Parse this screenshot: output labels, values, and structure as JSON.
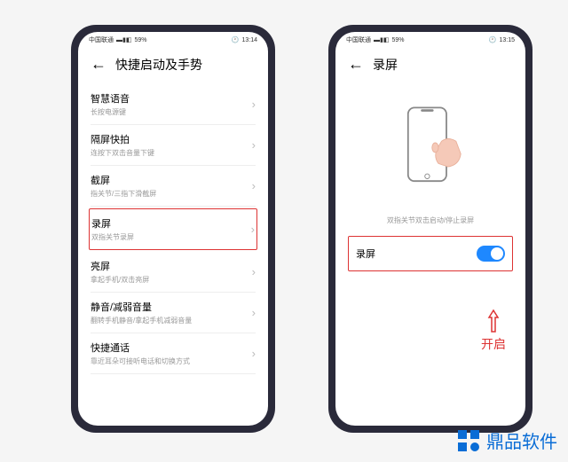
{
  "status": {
    "carrier": "中国联通",
    "signal": "▬▮◧",
    "battery": "59%",
    "time_left": "13:14",
    "time_right": "13:15"
  },
  "phone1": {
    "title": "快捷启动及手势",
    "items": [
      {
        "title": "智慧语音",
        "subtitle": "长按电源键"
      },
      {
        "title": "隔屏快拍",
        "subtitle": "连按下双击音量下键"
      },
      {
        "title": "截屏",
        "subtitle": "指关节/三指下滑截屏"
      },
      {
        "title": "录屏",
        "subtitle": "双指关节录屏"
      },
      {
        "title": "亮屏",
        "subtitle": "拿起手机/双击亮屏"
      },
      {
        "title": "静音/减弱音量",
        "subtitle": "翻转手机静音/拿起手机减弱音量"
      },
      {
        "title": "快捷通话",
        "subtitle": "靠近耳朵可接听电话和切换方式"
      }
    ]
  },
  "phone2": {
    "title": "录屏",
    "caption": "双指关节双击启动/停止录屏",
    "toggle_label": "录屏",
    "toggle_on": true
  },
  "annotation": "开启",
  "watermark": "鼎品软件"
}
